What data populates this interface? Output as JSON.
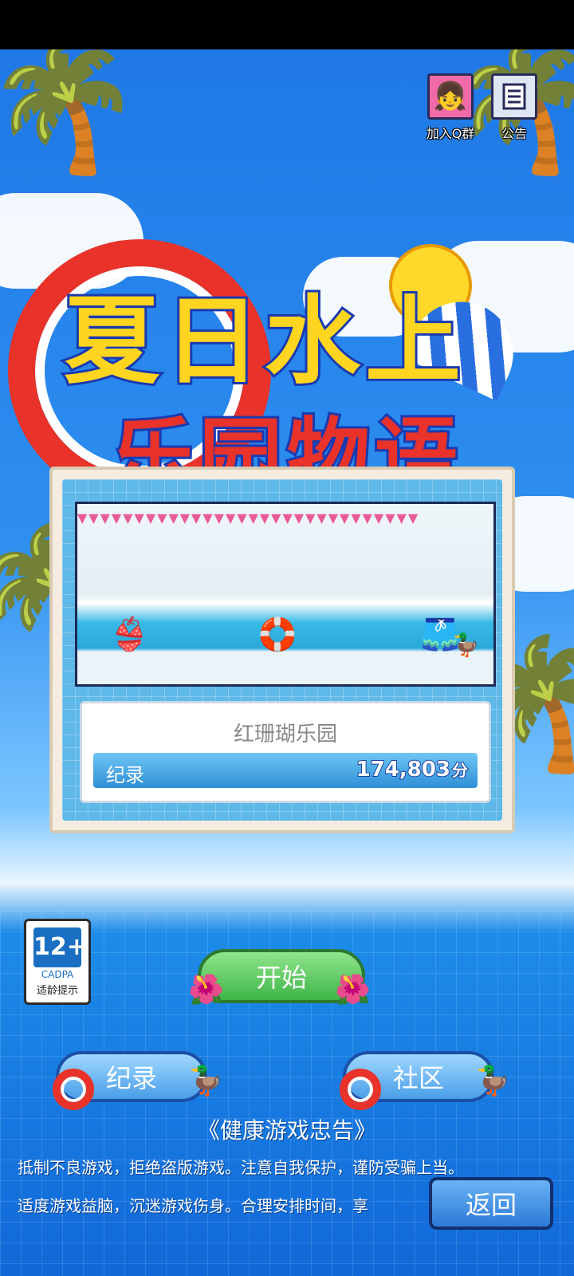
{
  "top_icons": [
    {
      "label": "加入Q群",
      "icon": "qq-group-avatar-icon"
    },
    {
      "label": "公告",
      "icon": "notice-document-icon"
    }
  ],
  "logo": {
    "line1": "夏日水上",
    "line2": "乐园物语"
  },
  "park": {
    "name": "红珊瑚乐园",
    "record_label": "纪录",
    "record_value": "174,803",
    "record_unit": "分"
  },
  "age_rating": {
    "number": "12+",
    "org": "CADPA",
    "tip": "适龄提示"
  },
  "buttons": {
    "start": "开始",
    "record": "纪录",
    "community": "社区",
    "back": "返回"
  },
  "notice": {
    "title": "《健康游戏忠告》",
    "line1": "抵制不良游戏，拒绝盗版游戏。注意自我保护，谨防受骗上当。",
    "line2": "适度游戏益脑，沉迷游戏伤身。合理安排时间，享"
  }
}
